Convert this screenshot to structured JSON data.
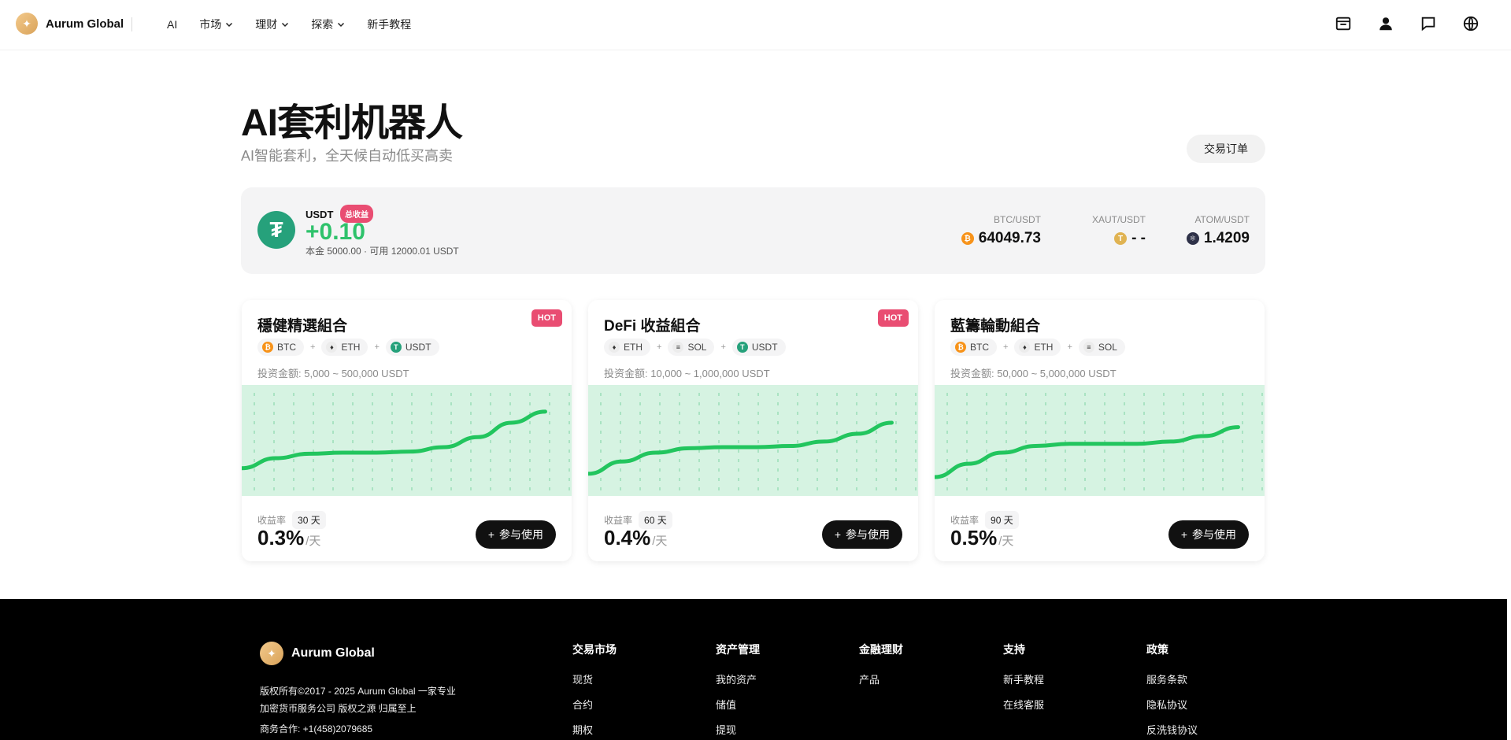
{
  "header": {
    "brand": "Aurum Global",
    "nav": [
      {
        "label": "AI",
        "has_dropdown": false
      },
      {
        "label": "市场",
        "has_dropdown": true
      },
      {
        "label": "理财",
        "has_dropdown": true
      },
      {
        "label": "探索",
        "has_dropdown": true
      },
      {
        "label": "新手教程",
        "has_dropdown": false
      }
    ],
    "icons": [
      "inbox-icon",
      "user-icon",
      "chat-icon",
      "globe-icon"
    ]
  },
  "hero": {
    "title": "AI套利机器人",
    "subtitle": "AI智能套利，全天候自动低买高卖",
    "orders_button": "交易订单"
  },
  "summary": {
    "currency": "USDT",
    "badge": "总收益",
    "value": "+0.10",
    "detail": "本金 5000.00 · 可用 12000.01 USDT",
    "tickers": [
      {
        "pair": "BTC/USDT",
        "price": "64049.73",
        "icon": "btc-icon",
        "color": "#f7931a",
        "glyph": "₿"
      },
      {
        "pair": "XAUT/USDT",
        "price": "- -",
        "icon": "xaut-icon",
        "color": "#e0b352",
        "glyph": "T"
      },
      {
        "pair": "ATOM/USDT",
        "price": "1.4209",
        "icon": "atom-icon",
        "color": "#2e3148",
        "glyph": "⚛"
      }
    ]
  },
  "cards": [
    {
      "title": "穩健精選組合",
      "badge": "HOT",
      "coins": [
        {
          "label": "BTC",
          "color": "#f7931a",
          "glyph": "₿"
        },
        {
          "label": "ETH",
          "color": "#ececec",
          "glyph": "♦"
        },
        {
          "label": "USDT",
          "color": "#26a17b",
          "glyph": "T"
        }
      ],
      "invest": "投资金额: 5,000 ~ 500,000 USDT",
      "rate_label": "收益率",
      "days": "30 天",
      "rate": "0.3%",
      "rate_unit": "/天",
      "button": "参与使用",
      "trend": [
        0.25,
        0.34,
        0.38,
        0.39,
        0.39,
        0.4,
        0.44,
        0.53,
        0.66,
        0.76
      ]
    },
    {
      "title": "DeFi 收益組合",
      "badge": "HOT",
      "coins": [
        {
          "label": "ETH",
          "color": "#ececec",
          "glyph": "♦"
        },
        {
          "label": "SOL",
          "color": "#ececec",
          "glyph": "≡"
        },
        {
          "label": "USDT",
          "color": "#26a17b",
          "glyph": "T"
        }
      ],
      "invest": "投资金额: 10,000 ~ 1,000,000 USDT",
      "rate_label": "收益率",
      "days": "60 天",
      "rate": "0.4%",
      "rate_unit": "/天",
      "button": "参与使用",
      "trend": [
        0.2,
        0.31,
        0.39,
        0.43,
        0.44,
        0.44,
        0.45,
        0.49,
        0.56,
        0.66
      ]
    },
    {
      "title": "藍籌輪動組合",
      "badge": "",
      "coins": [
        {
          "label": "BTC",
          "color": "#f7931a",
          "glyph": "₿"
        },
        {
          "label": "ETH",
          "color": "#ececec",
          "glyph": "♦"
        },
        {
          "label": "SOL",
          "color": "#ececec",
          "glyph": "≡"
        }
      ],
      "invest": "投资金额: 50,000 ~ 5,000,000 USDT",
      "rate_label": "收益率",
      "days": "90 天",
      "rate": "0.5%",
      "rate_unit": "/天",
      "button": "参与使用",
      "trend": [
        0.17,
        0.29,
        0.39,
        0.45,
        0.47,
        0.47,
        0.47,
        0.49,
        0.54,
        0.62
      ]
    }
  ],
  "footer": {
    "brand": "Aurum Global",
    "copyright_line1": "版权所有©2017 - 2025 Aurum Global 一家专业",
    "copyright_line2": "加密货币服务公司 版权之源 归属至上",
    "contact": "商务合作:  +1(458)2079685",
    "columns": [
      {
        "title": "交易市场",
        "links": [
          "现货",
          "合约",
          "期权"
        ]
      },
      {
        "title": "资产管理",
        "links": [
          "我的资产",
          "储值",
          "提现"
        ]
      },
      {
        "title": "金融理财",
        "links": [
          "产品"
        ]
      },
      {
        "title": "支持",
        "links": [
          "新手教程",
          "在线客服"
        ]
      },
      {
        "title": "政策",
        "links": [
          "服务条款",
          "隐私协议",
          "反洗钱协议"
        ]
      }
    ]
  }
}
